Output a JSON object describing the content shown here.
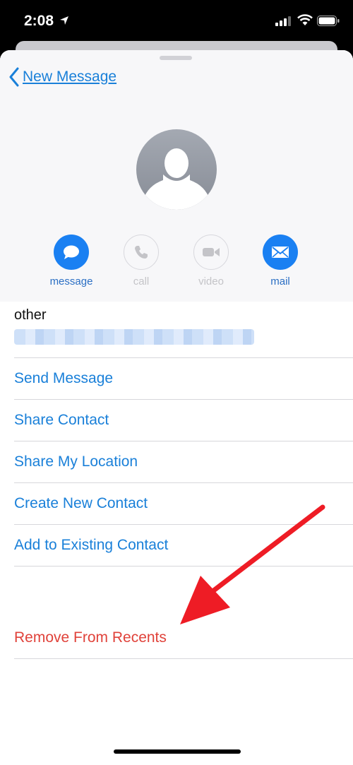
{
  "status_bar": {
    "time": "2:08",
    "icons": [
      "location-arrow-icon",
      "cellular-signal-icon",
      "wifi-icon",
      "battery-icon"
    ]
  },
  "nav": {
    "back_label": "New Message"
  },
  "actions": [
    {
      "label": "message",
      "icon": "message-bubble-icon",
      "enabled": true
    },
    {
      "label": "call",
      "icon": "phone-icon",
      "enabled": false
    },
    {
      "label": "video",
      "icon": "video-camera-icon",
      "enabled": false
    },
    {
      "label": "mail",
      "icon": "envelope-icon",
      "enabled": true
    }
  ],
  "contact_info": {
    "label": "other"
  },
  "menu": {
    "items": [
      "Send Message",
      "Share Contact",
      "Share My Location",
      "Create New Contact",
      "Add to Existing Contact"
    ],
    "destructive": "Remove From Recents"
  },
  "colors": {
    "accent": "#1a80d9",
    "destructive": "#e0423a",
    "annotation_arrow": "#ee1c25"
  }
}
